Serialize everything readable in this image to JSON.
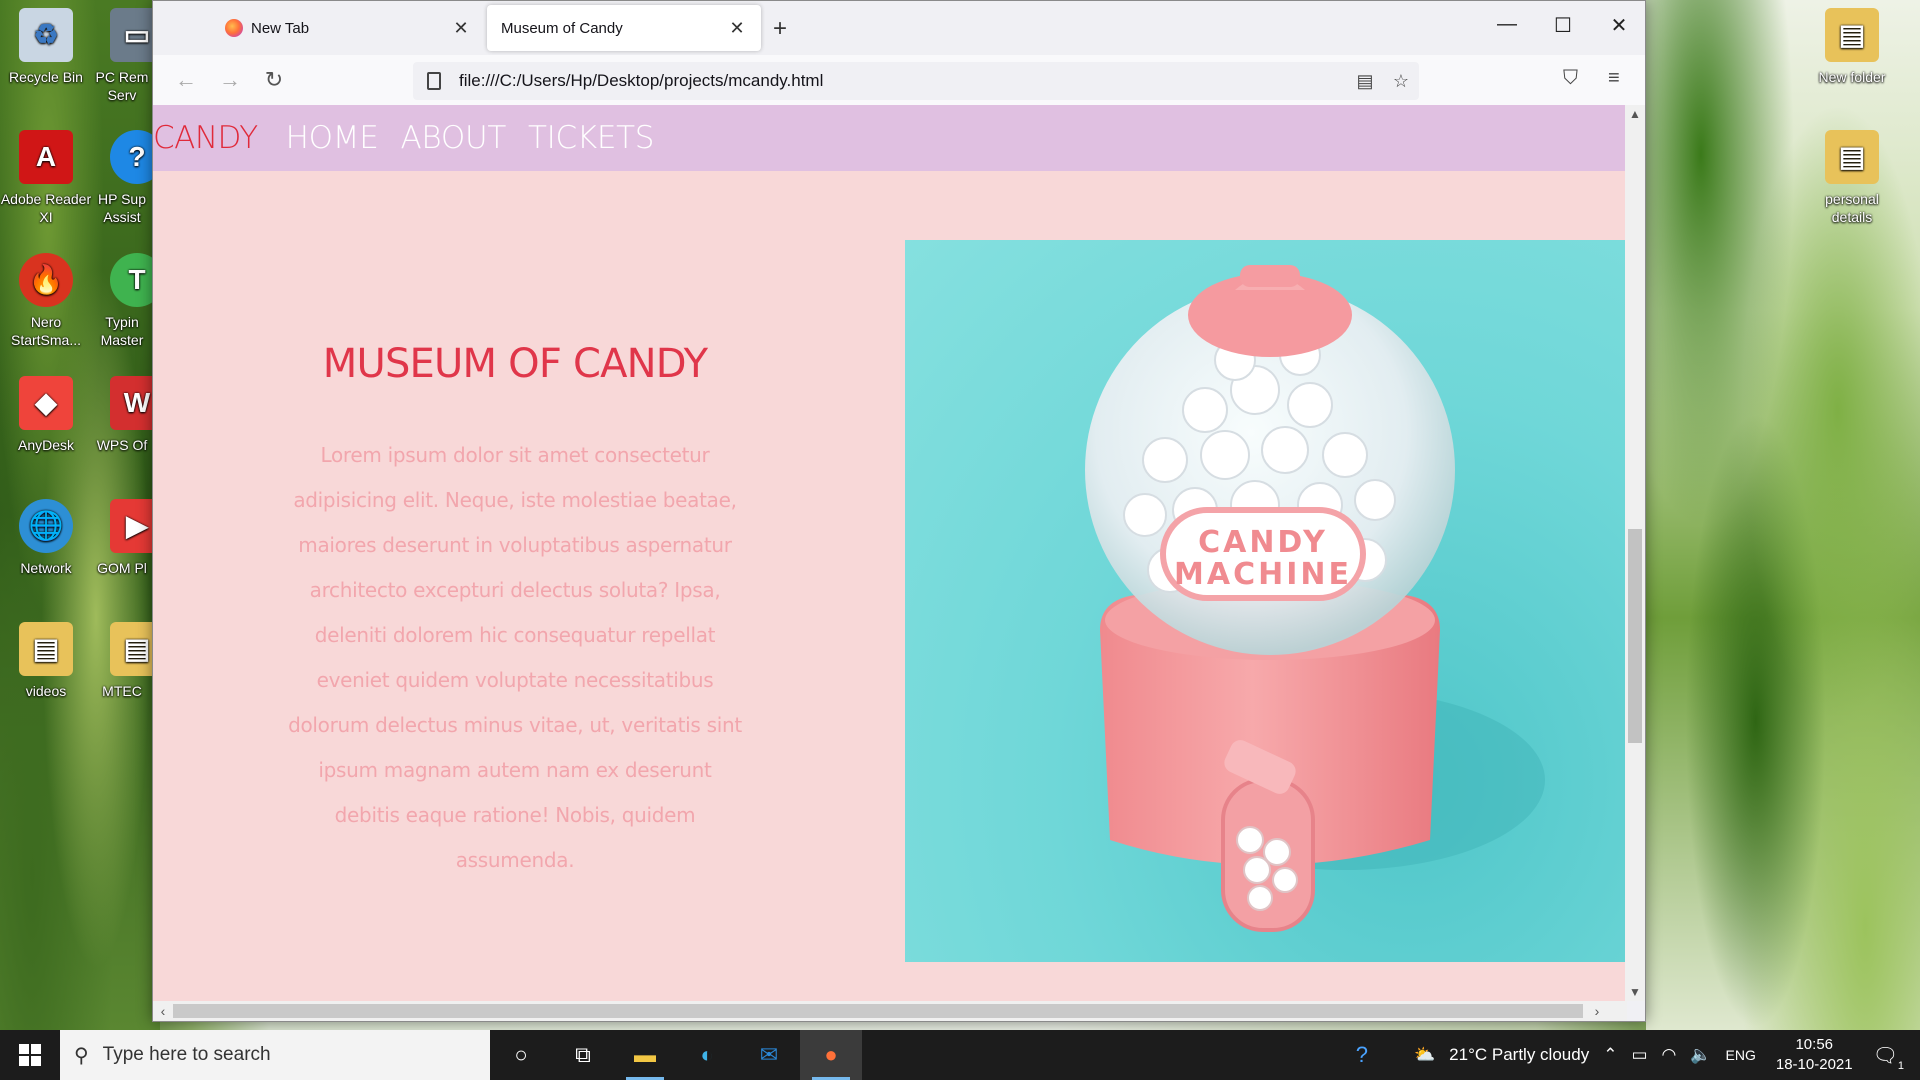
{
  "desktop": {
    "left_icons": [
      {
        "label": "Recycle Bin",
        "icon": "recycle-bin-icon",
        "color": "#c9d6e3"
      },
      {
        "label": "Adobe Reader XI",
        "icon": "adobe-reader-icon",
        "color": "#d01616"
      },
      {
        "label": "Nero StartSma...",
        "icon": "nero-icon",
        "color": "#d9331f"
      },
      {
        "label": "AnyDesk",
        "icon": "anydesk-icon",
        "color": "#ef443b"
      },
      {
        "label": "Network",
        "icon": "network-icon",
        "color": "#2d8fd5"
      },
      {
        "label": "videos",
        "icon": "folder-icon",
        "color": "#e8c25a"
      }
    ],
    "left_icons_col2": [
      {
        "label": "PC Rem Serv",
        "icon": "pc-remote-icon",
        "color": "#6b7b8a"
      },
      {
        "label": "HP Sup Assist",
        "icon": "hp-support-icon",
        "color": "#1e88e5"
      },
      {
        "label": "Typin Master",
        "icon": "typing-master-icon",
        "color": "#3fb34f"
      },
      {
        "label": "WPS Of",
        "icon": "wps-office-icon",
        "color": "#d32f2f"
      },
      {
        "label": "GOM Pl",
        "icon": "gom-player-icon",
        "color": "#e53935"
      },
      {
        "label": "MTEC",
        "icon": "folder-icon",
        "color": "#e8c25a"
      }
    ],
    "right_icons": [
      {
        "label": "New folder",
        "icon": "folder-icon",
        "color": "#e8c25a"
      },
      {
        "label": "personal details",
        "icon": "folder-icon",
        "color": "#e8c25a"
      }
    ]
  },
  "browser": {
    "tabs": [
      {
        "label": "New Tab",
        "active": false
      },
      {
        "label": "Museum of Candy",
        "active": true
      }
    ],
    "url": "file:///C:/Users/Hp/Desktop/projects/mcandy.html"
  },
  "page": {
    "nav": {
      "brand": "CANDY",
      "links": [
        "HOME",
        "ABOUT",
        "TICKETS"
      ]
    },
    "hero_title": "MUSEUM OF CANDY",
    "hero_text": "Lorem ipsum dolor sit amet consectetur adipisicing elit. Neque, iste molestiae beatae, maiores deserunt in voluptatibus aspernatur architecto excepturi delectus soluta? Ipsa, deleniti dolorem hic consequatur repellat eveniet quidem voluptate necessitatibus dolorum delectus minus vitae, ut, veritatis sint ipsum magnam autem nam ex deserunt debitis eaque ratione! Nobis, quidem assumenda.",
    "image_label_line1": "CANDY",
    "image_label_line2": "MACHINE"
  },
  "taskbar": {
    "search_placeholder": "Type here to search",
    "weather": "21°C  Partly cloudy",
    "language": "ENG",
    "time": "10:56",
    "date": "18-10-2021",
    "notifications": "1"
  }
}
